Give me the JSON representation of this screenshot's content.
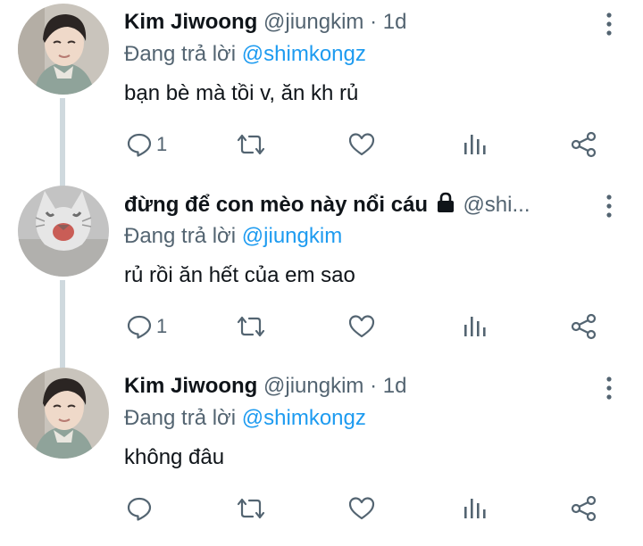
{
  "icons": {
    "reply": "speech-bubble-icon",
    "retweet": "retweet-icon",
    "like": "heart-icon",
    "analytics": "bar-chart-icon",
    "share": "share-nodes-icon",
    "more": "vertical-dots-icon",
    "lock": "lock-icon"
  },
  "colors": {
    "link": "#1d9bf0",
    "muted": "#536471",
    "text": "#0f1419",
    "thread_line": "#cfd9de"
  },
  "tweets": [
    {
      "name": "Kim Jiwoong",
      "handle": "@jiungkim",
      "separator": "·",
      "time": "1d",
      "reply_prefix": "Đang trả lời",
      "reply_to": "@shimkongz",
      "text": "bạn bè mà tồi v, ăn kh rủ",
      "reply_count": "1"
    },
    {
      "name": "đừng để con mèo này nổi cáu",
      "handle": "@shi...",
      "reply_prefix": "Đang trả lời",
      "reply_to": "@jiungkim",
      "text": "rủ rồi ăn hết của em sao",
      "reply_count": "1"
    },
    {
      "name": "Kim Jiwoong",
      "handle": "@jiungkim",
      "separator": "·",
      "time": "1d",
      "reply_prefix": "Đang trả lời",
      "reply_to": "@shimkongz",
      "text": "không đâu",
      "reply_count": ""
    }
  ]
}
